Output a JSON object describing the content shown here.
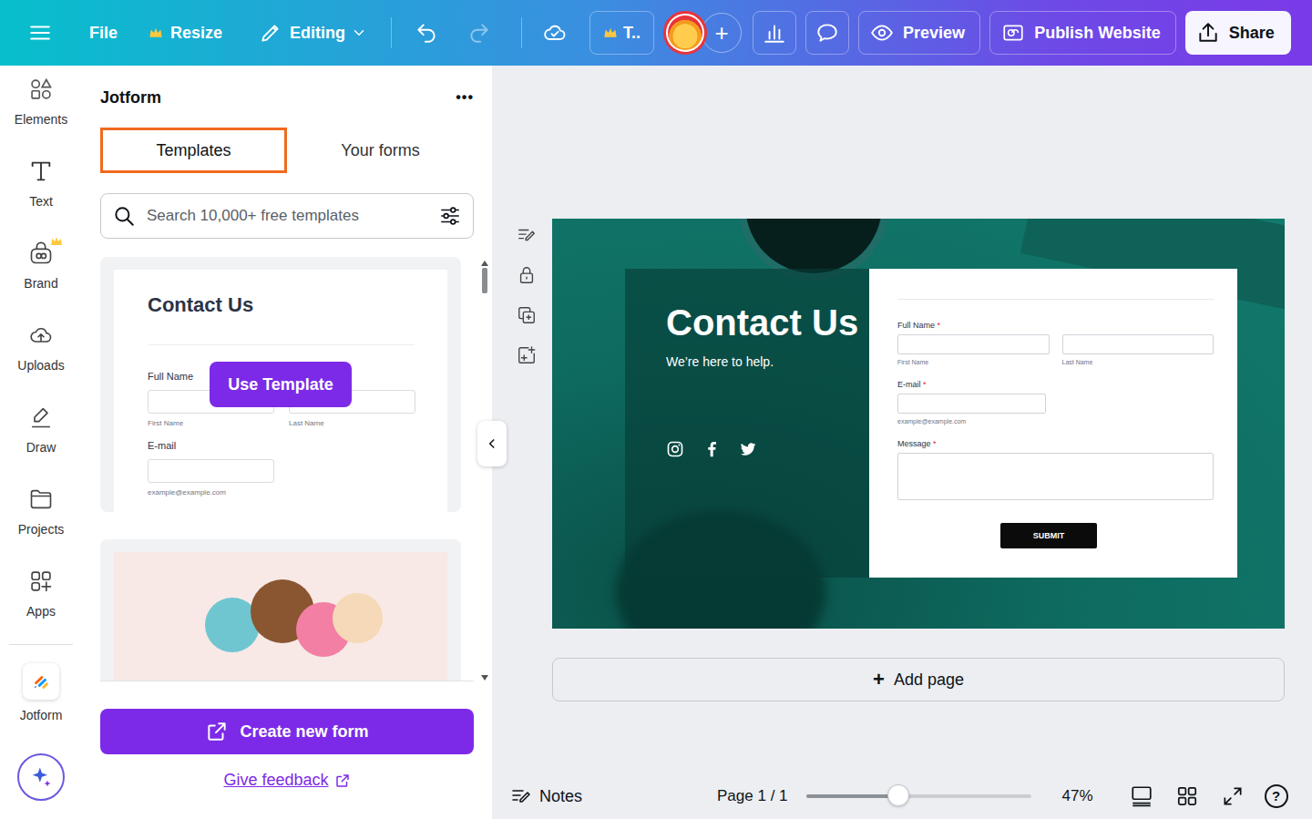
{
  "topbar": {
    "file": "File",
    "resize": {
      "label": "Resize",
      "premium": true
    },
    "editing": {
      "label": "Editing"
    },
    "history": {
      "undo_disabled": false,
      "redo_disabled": true
    },
    "team": {
      "label": "T..",
      "premium": true
    },
    "add": "+",
    "preview": "Preview",
    "publish": "Publish Website",
    "share": "Share"
  },
  "rail": {
    "items": [
      {
        "label": "Elements",
        "premium": false
      },
      {
        "label": "Text",
        "premium": false
      },
      {
        "label": "Brand",
        "premium": true
      },
      {
        "label": "Uploads",
        "premium": false
      },
      {
        "label": "Draw",
        "premium": false
      },
      {
        "label": "Projects",
        "premium": false
      },
      {
        "label": "Apps",
        "premium": false
      }
    ],
    "app": {
      "label": "Jotform",
      "selected": true
    }
  },
  "panel": {
    "title": "Jotform",
    "menu": "•••",
    "tabs": [
      {
        "label": "Templates",
        "selected": true
      },
      {
        "label": "Your forms",
        "selected": false
      }
    ],
    "search": {
      "placeholder": "Search 10,000+ free templates"
    },
    "templates": [
      {
        "kind": "form",
        "title": "Contact Us",
        "name_label": "Full Name",
        "first": "First Name",
        "last": "Last Name",
        "email_label": "E-mail",
        "email_hint": "example@example.com",
        "hovered": true,
        "action": "Use Template"
      },
      {
        "kind": "image"
      }
    ],
    "create": "Create new form",
    "feedback": "Give feedback"
  },
  "design": {
    "title": "Contact Us",
    "subtitle": "We’re here to help.",
    "form": {
      "required_mark": "*",
      "name_label": "Full Name",
      "first": "First Name",
      "last": "Last Name",
      "email_label": "E-mail",
      "email_hint": "example@example.com",
      "message_label": "Message",
      "submit": "SUBMIT"
    }
  },
  "add_page": {
    "icon": "+",
    "label": "Add page"
  },
  "footer": {
    "notes": "Notes",
    "page": "Page 1 / 1",
    "zoom": {
      "level": 0.41,
      "reading": "47%"
    },
    "help": "?"
  }
}
